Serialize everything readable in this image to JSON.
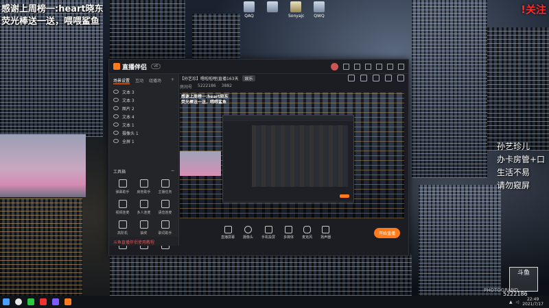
{
  "overlay": {
    "line1": "感谢上周榜一:heart晓东",
    "line2": "荧光棒送一送，喂喂鲨鱼",
    "follow": "!关注",
    "right_lines": [
      "孙艺珍儿",
      "办卡房管+口",
      "生活不易",
      "请勿窥屏"
    ],
    "platform_logo": "斗鱼",
    "room_number": "5222186",
    "watermark": "PHOTOGRAND"
  },
  "desktop_icons": [
    "QAQ",
    "",
    "Sonyajc",
    "QWQ"
  ],
  "app": {
    "name": "直播伴侣",
    "version": "v6",
    "tabs": [
      "场景设置",
      "互动",
      "组播场"
    ],
    "scenes": [
      "文本 3",
      "文本 3",
      "图片 2",
      "文本 4",
      "文本 1",
      "摄像头 1",
      "全屏 1"
    ],
    "tools_label": "工具箱",
    "tools": [
      "弹幕助手",
      "房管助手",
      "主播任务",
      "视频连麦",
      "多人连麦",
      "语音连麦",
      "高阶机",
      "抽奖",
      "歌词助手",
      "",
      "",
      ""
    ],
    "notice": "斗鱼直播伴侣使用教程",
    "stream_title": "【孙艺珍】噜啦啦哩|直播163天",
    "live_badge": "娱乐",
    "room_label": "房间号",
    "room_id": "5222186",
    "followers": "3882",
    "preview_text_1": "感谢上周榜一:heart晓东",
    "preview_text_2": "荧光棒送一送，喂喂鲨鱼",
    "bottom_actions": [
      "直播屏幕",
      "摄像头",
      "手机投屏",
      "多媒体",
      "麦克风",
      "扬声器"
    ],
    "start_button": "开始直播",
    "status_bar": [
      "",
      "",
      "",
      "",
      ""
    ]
  },
  "taskbar": {
    "time": "22:49",
    "date": "2021/7/17"
  }
}
